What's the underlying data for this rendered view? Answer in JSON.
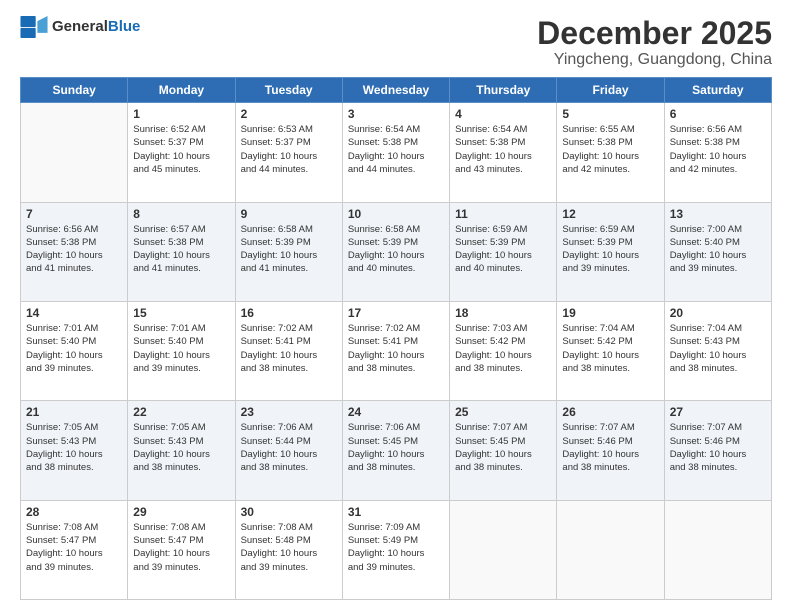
{
  "logo": {
    "general": "General",
    "blue": "Blue"
  },
  "header": {
    "title": "December 2025",
    "subtitle": "Yingcheng, Guangdong, China"
  },
  "weekdays": [
    "Sunday",
    "Monday",
    "Tuesday",
    "Wednesday",
    "Thursday",
    "Friday",
    "Saturday"
  ],
  "weeks": [
    [
      {
        "day": "",
        "info": ""
      },
      {
        "day": "1",
        "info": "Sunrise: 6:52 AM\nSunset: 5:37 PM\nDaylight: 10 hours\nand 45 minutes."
      },
      {
        "day": "2",
        "info": "Sunrise: 6:53 AM\nSunset: 5:37 PM\nDaylight: 10 hours\nand 44 minutes."
      },
      {
        "day": "3",
        "info": "Sunrise: 6:54 AM\nSunset: 5:38 PM\nDaylight: 10 hours\nand 44 minutes."
      },
      {
        "day": "4",
        "info": "Sunrise: 6:54 AM\nSunset: 5:38 PM\nDaylight: 10 hours\nand 43 minutes."
      },
      {
        "day": "5",
        "info": "Sunrise: 6:55 AM\nSunset: 5:38 PM\nDaylight: 10 hours\nand 42 minutes."
      },
      {
        "day": "6",
        "info": "Sunrise: 6:56 AM\nSunset: 5:38 PM\nDaylight: 10 hours\nand 42 minutes."
      }
    ],
    [
      {
        "day": "7",
        "info": "Sunrise: 6:56 AM\nSunset: 5:38 PM\nDaylight: 10 hours\nand 41 minutes."
      },
      {
        "day": "8",
        "info": "Sunrise: 6:57 AM\nSunset: 5:38 PM\nDaylight: 10 hours\nand 41 minutes."
      },
      {
        "day": "9",
        "info": "Sunrise: 6:58 AM\nSunset: 5:39 PM\nDaylight: 10 hours\nand 41 minutes."
      },
      {
        "day": "10",
        "info": "Sunrise: 6:58 AM\nSunset: 5:39 PM\nDaylight: 10 hours\nand 40 minutes."
      },
      {
        "day": "11",
        "info": "Sunrise: 6:59 AM\nSunset: 5:39 PM\nDaylight: 10 hours\nand 40 minutes."
      },
      {
        "day": "12",
        "info": "Sunrise: 6:59 AM\nSunset: 5:39 PM\nDaylight: 10 hours\nand 39 minutes."
      },
      {
        "day": "13",
        "info": "Sunrise: 7:00 AM\nSunset: 5:40 PM\nDaylight: 10 hours\nand 39 minutes."
      }
    ],
    [
      {
        "day": "14",
        "info": "Sunrise: 7:01 AM\nSunset: 5:40 PM\nDaylight: 10 hours\nand 39 minutes."
      },
      {
        "day": "15",
        "info": "Sunrise: 7:01 AM\nSunset: 5:40 PM\nDaylight: 10 hours\nand 39 minutes."
      },
      {
        "day": "16",
        "info": "Sunrise: 7:02 AM\nSunset: 5:41 PM\nDaylight: 10 hours\nand 38 minutes."
      },
      {
        "day": "17",
        "info": "Sunrise: 7:02 AM\nSunset: 5:41 PM\nDaylight: 10 hours\nand 38 minutes."
      },
      {
        "day": "18",
        "info": "Sunrise: 7:03 AM\nSunset: 5:42 PM\nDaylight: 10 hours\nand 38 minutes."
      },
      {
        "day": "19",
        "info": "Sunrise: 7:04 AM\nSunset: 5:42 PM\nDaylight: 10 hours\nand 38 minutes."
      },
      {
        "day": "20",
        "info": "Sunrise: 7:04 AM\nSunset: 5:43 PM\nDaylight: 10 hours\nand 38 minutes."
      }
    ],
    [
      {
        "day": "21",
        "info": "Sunrise: 7:05 AM\nSunset: 5:43 PM\nDaylight: 10 hours\nand 38 minutes."
      },
      {
        "day": "22",
        "info": "Sunrise: 7:05 AM\nSunset: 5:43 PM\nDaylight: 10 hours\nand 38 minutes."
      },
      {
        "day": "23",
        "info": "Sunrise: 7:06 AM\nSunset: 5:44 PM\nDaylight: 10 hours\nand 38 minutes."
      },
      {
        "day": "24",
        "info": "Sunrise: 7:06 AM\nSunset: 5:45 PM\nDaylight: 10 hours\nand 38 minutes."
      },
      {
        "day": "25",
        "info": "Sunrise: 7:07 AM\nSunset: 5:45 PM\nDaylight: 10 hours\nand 38 minutes."
      },
      {
        "day": "26",
        "info": "Sunrise: 7:07 AM\nSunset: 5:46 PM\nDaylight: 10 hours\nand 38 minutes."
      },
      {
        "day": "27",
        "info": "Sunrise: 7:07 AM\nSunset: 5:46 PM\nDaylight: 10 hours\nand 38 minutes."
      }
    ],
    [
      {
        "day": "28",
        "info": "Sunrise: 7:08 AM\nSunset: 5:47 PM\nDaylight: 10 hours\nand 39 minutes."
      },
      {
        "day": "29",
        "info": "Sunrise: 7:08 AM\nSunset: 5:47 PM\nDaylight: 10 hours\nand 39 minutes."
      },
      {
        "day": "30",
        "info": "Sunrise: 7:08 AM\nSunset: 5:48 PM\nDaylight: 10 hours\nand 39 minutes."
      },
      {
        "day": "31",
        "info": "Sunrise: 7:09 AM\nSunset: 5:49 PM\nDaylight: 10 hours\nand 39 minutes."
      },
      {
        "day": "",
        "info": ""
      },
      {
        "day": "",
        "info": ""
      },
      {
        "day": "",
        "info": ""
      }
    ]
  ]
}
